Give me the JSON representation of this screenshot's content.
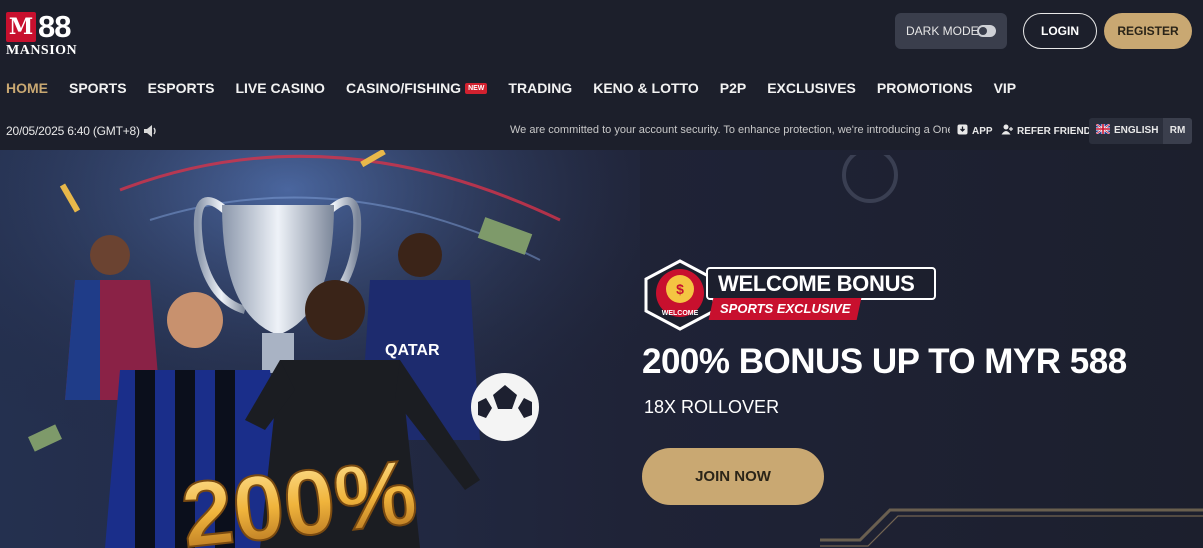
{
  "brand": {
    "logo_mark": "M",
    "logo_number": "88",
    "logo_name": "MANSION"
  },
  "header": {
    "dark_mode_label": "DARK MODE",
    "dark_mode_on": false,
    "login_label": "LOGIN",
    "register_label": "REGISTER"
  },
  "nav": {
    "items": [
      {
        "label": "HOME",
        "active": true
      },
      {
        "label": "SPORTS"
      },
      {
        "label": "ESPORTS"
      },
      {
        "label": "LIVE CASINO"
      },
      {
        "label": "CASINO/FISHING",
        "badge": "NEW"
      },
      {
        "label": "TRADING"
      },
      {
        "label": "KENO & LOTTO"
      },
      {
        "label": "P2P"
      },
      {
        "label": "EXCLUSIVES"
      },
      {
        "label": "PROMOTIONS"
      },
      {
        "label": "VIP"
      }
    ]
  },
  "infobar": {
    "datetime": "20/05/2025 6:40 (GMT+8)",
    "announcement": "We are committed to your account security. To enhance protection, we're introducing a One-T",
    "app_label": "APP",
    "refer_label": "REFER FRIEND",
    "language_label": "ENGLISH",
    "currency_label": "RM"
  },
  "banner": {
    "badge_text": "WELCOME",
    "title": "WELCOME BONUS",
    "subtitle": "SPORTS EXCLUSIVE",
    "headline": "200% BONUS UP TO MYR 588",
    "rollover": "18X ROLLOVER",
    "join_label": "JOIN NOW",
    "art_text": "200%"
  },
  "colors": {
    "background": "#1c1f2b",
    "accent_gold": "#c9a872",
    "brand_red": "#c8102e"
  },
  "icons": [
    "speaker-icon",
    "app-icon",
    "refer-friend-icon",
    "uk-flag-icon"
  ]
}
